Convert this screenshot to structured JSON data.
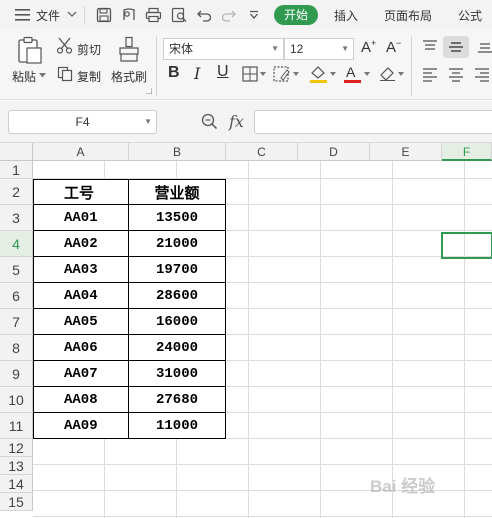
{
  "menu": {
    "file_label": "文件",
    "tabs": [
      "开始",
      "插入",
      "页面布局",
      "公式"
    ]
  },
  "ribbon": {
    "paste_label": "粘贴",
    "cut_label": "剪切",
    "copy_label": "复制",
    "format_painter_label": "格式刷",
    "font_name": "宋体",
    "font_size": "12",
    "bold_label": "B",
    "italic_label": "I",
    "underline_label": "U",
    "font_color_label": "A"
  },
  "formula_bar": {
    "name_box": "F4",
    "fx_label": "fx",
    "formula_value": ""
  },
  "grid": {
    "columns": [
      "A",
      "B",
      "C",
      "D",
      "E",
      "F"
    ],
    "rows": [
      "1",
      "2",
      "3",
      "4",
      "5",
      "6",
      "7",
      "8",
      "9",
      "10",
      "11",
      "12",
      "13",
      "14",
      "15"
    ],
    "selected_cell": "F4",
    "table_header": [
      "工号",
      "营业额"
    ],
    "table_rows": [
      [
        "AA01",
        "13500"
      ],
      [
        "AA02",
        "21000"
      ],
      [
        "AA03",
        "19700"
      ],
      [
        "AA04",
        "28600"
      ],
      [
        "AA05",
        "16000"
      ],
      [
        "AA06",
        "24000"
      ],
      [
        "AA07",
        "31000"
      ],
      [
        "AA08",
        "27680"
      ],
      [
        "AA09",
        "11000"
      ]
    ]
  },
  "colors": {
    "accent": "#2f9a50",
    "fill_underline": "#f5c400",
    "font_color_underline": "#e02020"
  },
  "watermark": "Bai 经验"
}
